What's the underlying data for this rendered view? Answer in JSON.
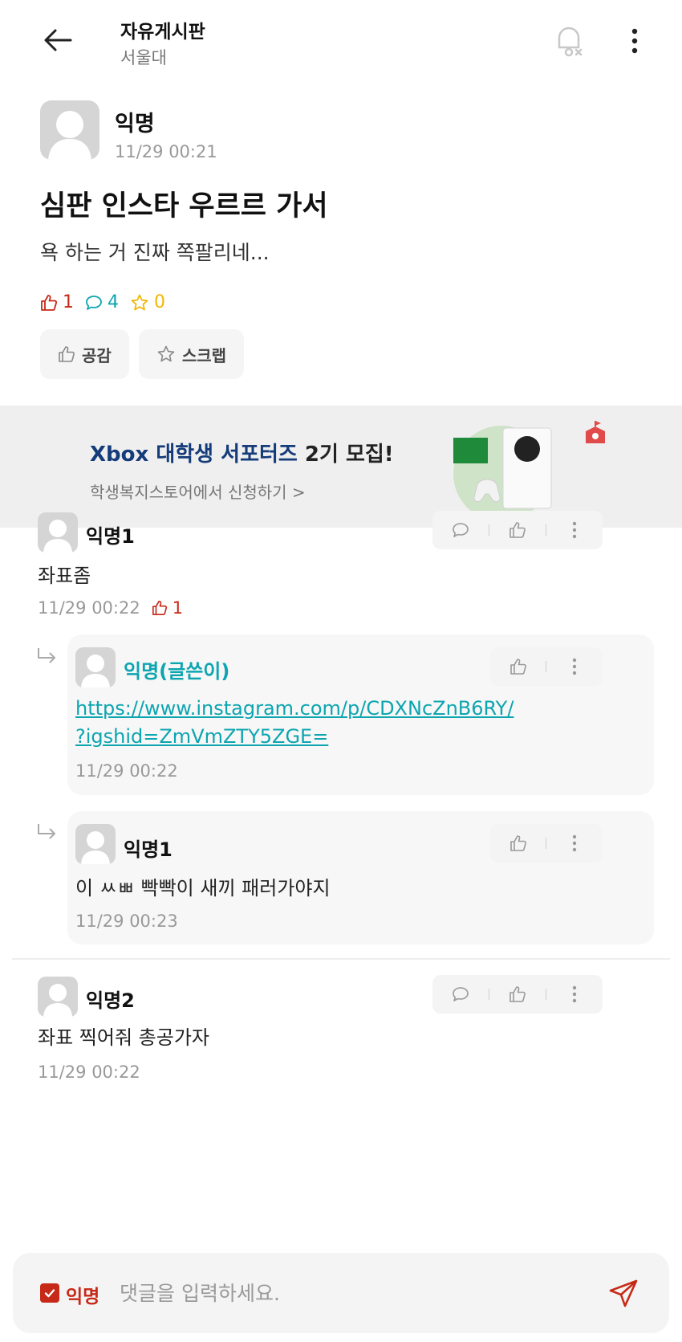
{
  "header": {
    "title": "자유게시판",
    "subtitle": "서울대"
  },
  "post": {
    "author": "익명",
    "time": "11/29 00:21",
    "title": "심판 인스타 우르르 가서",
    "body": "욕 하는 거 진짜 쪽팔리네...",
    "likes": "1",
    "comments": "4",
    "scraps": "0",
    "like_button": "공감",
    "scrap_button": "스크랩"
  },
  "banner": {
    "title_highlight": "Xbox 대학생 서포터즈",
    "title_rest": " 2기 모집!",
    "subtitle": "학생복지스토어에서 신청하기 >"
  },
  "comments": [
    {
      "author": "익명1",
      "text": "좌표좀",
      "time": "11/29 00:22",
      "likes": "1",
      "replies": [
        {
          "author": "익명(글쓴이)",
          "link_line1": "https://www.instagram.com/p/CDXNcZnB6RY/",
          "link_line2": "?igshid=ZmVmZTY5ZGE=",
          "time": "11/29 00:22"
        },
        {
          "author": "익명1",
          "text": "이 ㅆㅃ 빡빡이 새끼 패러가야지",
          "time": "11/29 00:23"
        }
      ]
    },
    {
      "author": "익명2",
      "text": "좌표 찍어줘 총공가자",
      "time": "11/29 00:22"
    }
  ],
  "input": {
    "anon_label": "익명",
    "placeholder": "댓글을 입력하세요."
  },
  "colors": {
    "accent_red": "#c62917",
    "accent_teal": "#0ca5b0",
    "accent_yellow": "#f2b705",
    "xbox_blue": "#143b7a"
  }
}
